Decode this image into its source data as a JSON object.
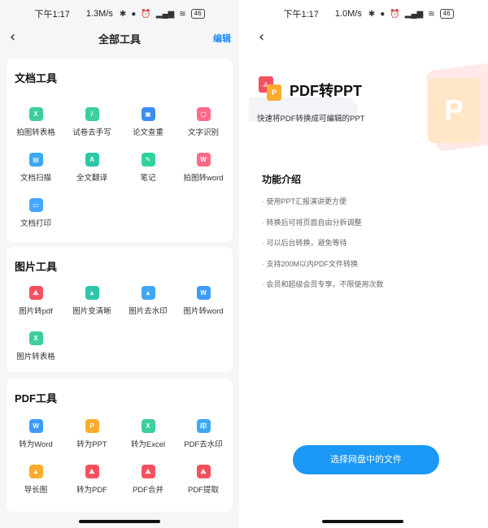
{
  "status_left": {
    "time": "下午1:17",
    "speed": "1.3M/s",
    "battery": "46"
  },
  "status_right": {
    "time": "下午1:17",
    "speed": "1.0M/s",
    "battery": "46"
  },
  "left_nav": {
    "title": "全部工具",
    "edit": "编辑"
  },
  "sections": {
    "doc": {
      "title": "文档工具",
      "tools": [
        {
          "label": "拍图转表格",
          "glyph": "X"
        },
        {
          "label": "试卷去手写",
          "glyph": "/"
        },
        {
          "label": "论文查重",
          "glyph": "▣"
        },
        {
          "label": "文字识别",
          "glyph": "▢"
        },
        {
          "label": "文档扫描",
          "glyph": "▤"
        },
        {
          "label": "全文翻译",
          "glyph": "A"
        },
        {
          "label": "笔记",
          "glyph": "✎"
        },
        {
          "label": "拍图转word",
          "glyph": "W"
        },
        {
          "label": "文档打印",
          "glyph": "▭"
        }
      ]
    },
    "img": {
      "title": "图片工具",
      "tools": [
        {
          "label": "图片转pdf",
          "glyph": "⟁"
        },
        {
          "label": "图片变清晰",
          "glyph": "▲"
        },
        {
          "label": "图片去水印",
          "glyph": "▲"
        },
        {
          "label": "图片转word",
          "glyph": "W"
        },
        {
          "label": "图片转表格",
          "glyph": "X"
        }
      ]
    },
    "pdf": {
      "title": "PDF工具",
      "tools": [
        {
          "label": "转为Word",
          "glyph": "W"
        },
        {
          "label": "转为PPT",
          "glyph": "P"
        },
        {
          "label": "转为Excel",
          "glyph": "X"
        },
        {
          "label": "PDF去水印",
          "glyph": "印"
        },
        {
          "label": "导长图",
          "glyph": "▲"
        },
        {
          "label": "转为PDF",
          "glyph": "⟁"
        },
        {
          "label": "PDF合并",
          "glyph": "⟁"
        },
        {
          "label": "PDF提取",
          "glyph": "⟁"
        }
      ]
    }
  },
  "right": {
    "title": "PDF转PPT",
    "subtitle": "快速将PDF转换成可编辑的PPT",
    "features_title": "功能介绍",
    "features": [
      "使用PPT汇报演讲更方便",
      "转换后可将页面自由分拆调整",
      "可以后台转换，避免等待",
      "支持200M以内PDF文件转换",
      "会员和超级会员专享，不限使用次数"
    ],
    "cta": "选择网盘中的文件"
  }
}
